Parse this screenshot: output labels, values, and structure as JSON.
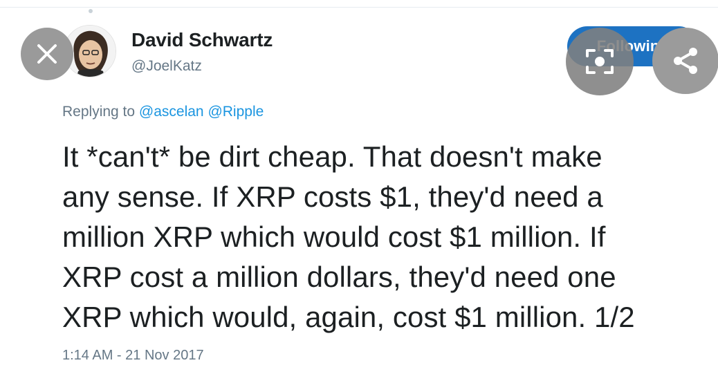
{
  "tweet": {
    "author_name": "David Schwartz",
    "author_handle": "@JoelKatz",
    "follow_label": "Following",
    "reply_prefix": "Replying to",
    "reply_mentions": [
      "@ascelan",
      "@Ripple"
    ],
    "text_lines": [
      "It *can't* be dirt cheap. That doesn't make",
      "any sense. If XRP costs $1, they'd need a",
      "million XRP which would cost $1 million. If",
      "XRP cost a million dollars, they'd need one",
      "XRP which would, again, cost $1 million. 1/2"
    ],
    "timestamp": "1:14 AM - 21 Nov 2017"
  },
  "overlay": {
    "close_icon": "close-icon",
    "lens_icon": "lens-icon",
    "share_icon": "share-icon"
  },
  "colors": {
    "link": "#1b95e0",
    "follow_bg": "#1d72c2",
    "muted": "#657786",
    "text": "#1c2022",
    "overlay_button": "#9b9b9b"
  }
}
